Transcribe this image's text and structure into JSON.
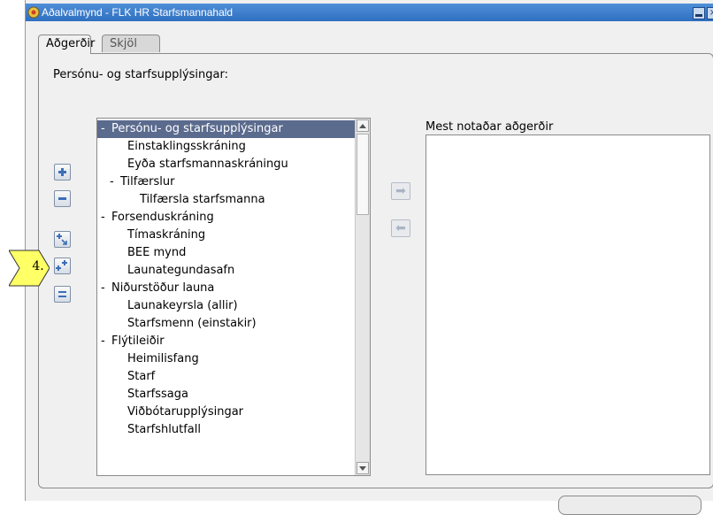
{
  "window": {
    "title": "Aðalvalmynd - FLK HR Starfsmannahald"
  },
  "tabs": [
    {
      "label": "Aðgerðir",
      "active": true
    },
    {
      "label": "Skjöl",
      "active": false
    }
  ],
  "panel": {
    "section_label": "Persónu- og starfsupplýsingar:"
  },
  "side_buttons": [
    {
      "name": "expand",
      "icon": "plus-icon"
    },
    {
      "name": "collapse",
      "icon": "minus-icon"
    },
    {
      "name": "expand-branch",
      "icon": "expand-branch-icon"
    },
    {
      "name": "expand-all",
      "icon": "expand-all-icon"
    },
    {
      "name": "collapse-all",
      "icon": "collapse-all-icon"
    }
  ],
  "tree": {
    "items": [
      {
        "label": "Persónu- og starfsupplýsingar",
        "level": 0,
        "expander": "-",
        "selected": true
      },
      {
        "label": "Einstaklingsskráning",
        "level": 2,
        "expander": ""
      },
      {
        "label": "Eyða starfsmannaskráningu",
        "level": 2,
        "expander": ""
      },
      {
        "label": "Tilfærslur",
        "level": 1,
        "expander": "-"
      },
      {
        "label": "Tilfærsla starfsmanna",
        "level": 3,
        "expander": ""
      },
      {
        "label": "Forsenduskráning",
        "level": 0,
        "expander": "-"
      },
      {
        "label": "Tímaskráning",
        "level": 2,
        "expander": ""
      },
      {
        "label": "BEE mynd",
        "level": 2,
        "expander": ""
      },
      {
        "label": "Launategundasafn",
        "level": 2,
        "expander": ""
      },
      {
        "label": "Niðurstöður launa",
        "level": 0,
        "expander": "-"
      },
      {
        "label": "Launakeyrsla (allir)",
        "level": 2,
        "expander": ""
      },
      {
        "label": "Starfsmenn (einstakir)",
        "level": 2,
        "expander": ""
      },
      {
        "label": "Flýtileiðir",
        "level": 0,
        "expander": "-"
      },
      {
        "label": "Heimilisfang",
        "level": 2,
        "expander": ""
      },
      {
        "label": "Starf",
        "level": 2,
        "expander": ""
      },
      {
        "label": "Starfssaga",
        "level": 2,
        "expander": ""
      },
      {
        "label": "Viðbótarupplýsingar",
        "level": 2,
        "expander": ""
      },
      {
        "label": "Starfshlutfall",
        "level": 2,
        "expander": ""
      }
    ]
  },
  "move_buttons": [
    {
      "icon": "arrow-right-icon",
      "glyph": "➡"
    },
    {
      "icon": "arrow-left-icon",
      "glyph": "⬅"
    }
  ],
  "right_panel": {
    "label": "Mest notaðar aðgerðir"
  },
  "callout": {
    "text": "4."
  },
  "colors": {
    "titlebar": "#3a7bd0",
    "selection": "#5b6b8e",
    "callout_fill": "#ffff66"
  }
}
